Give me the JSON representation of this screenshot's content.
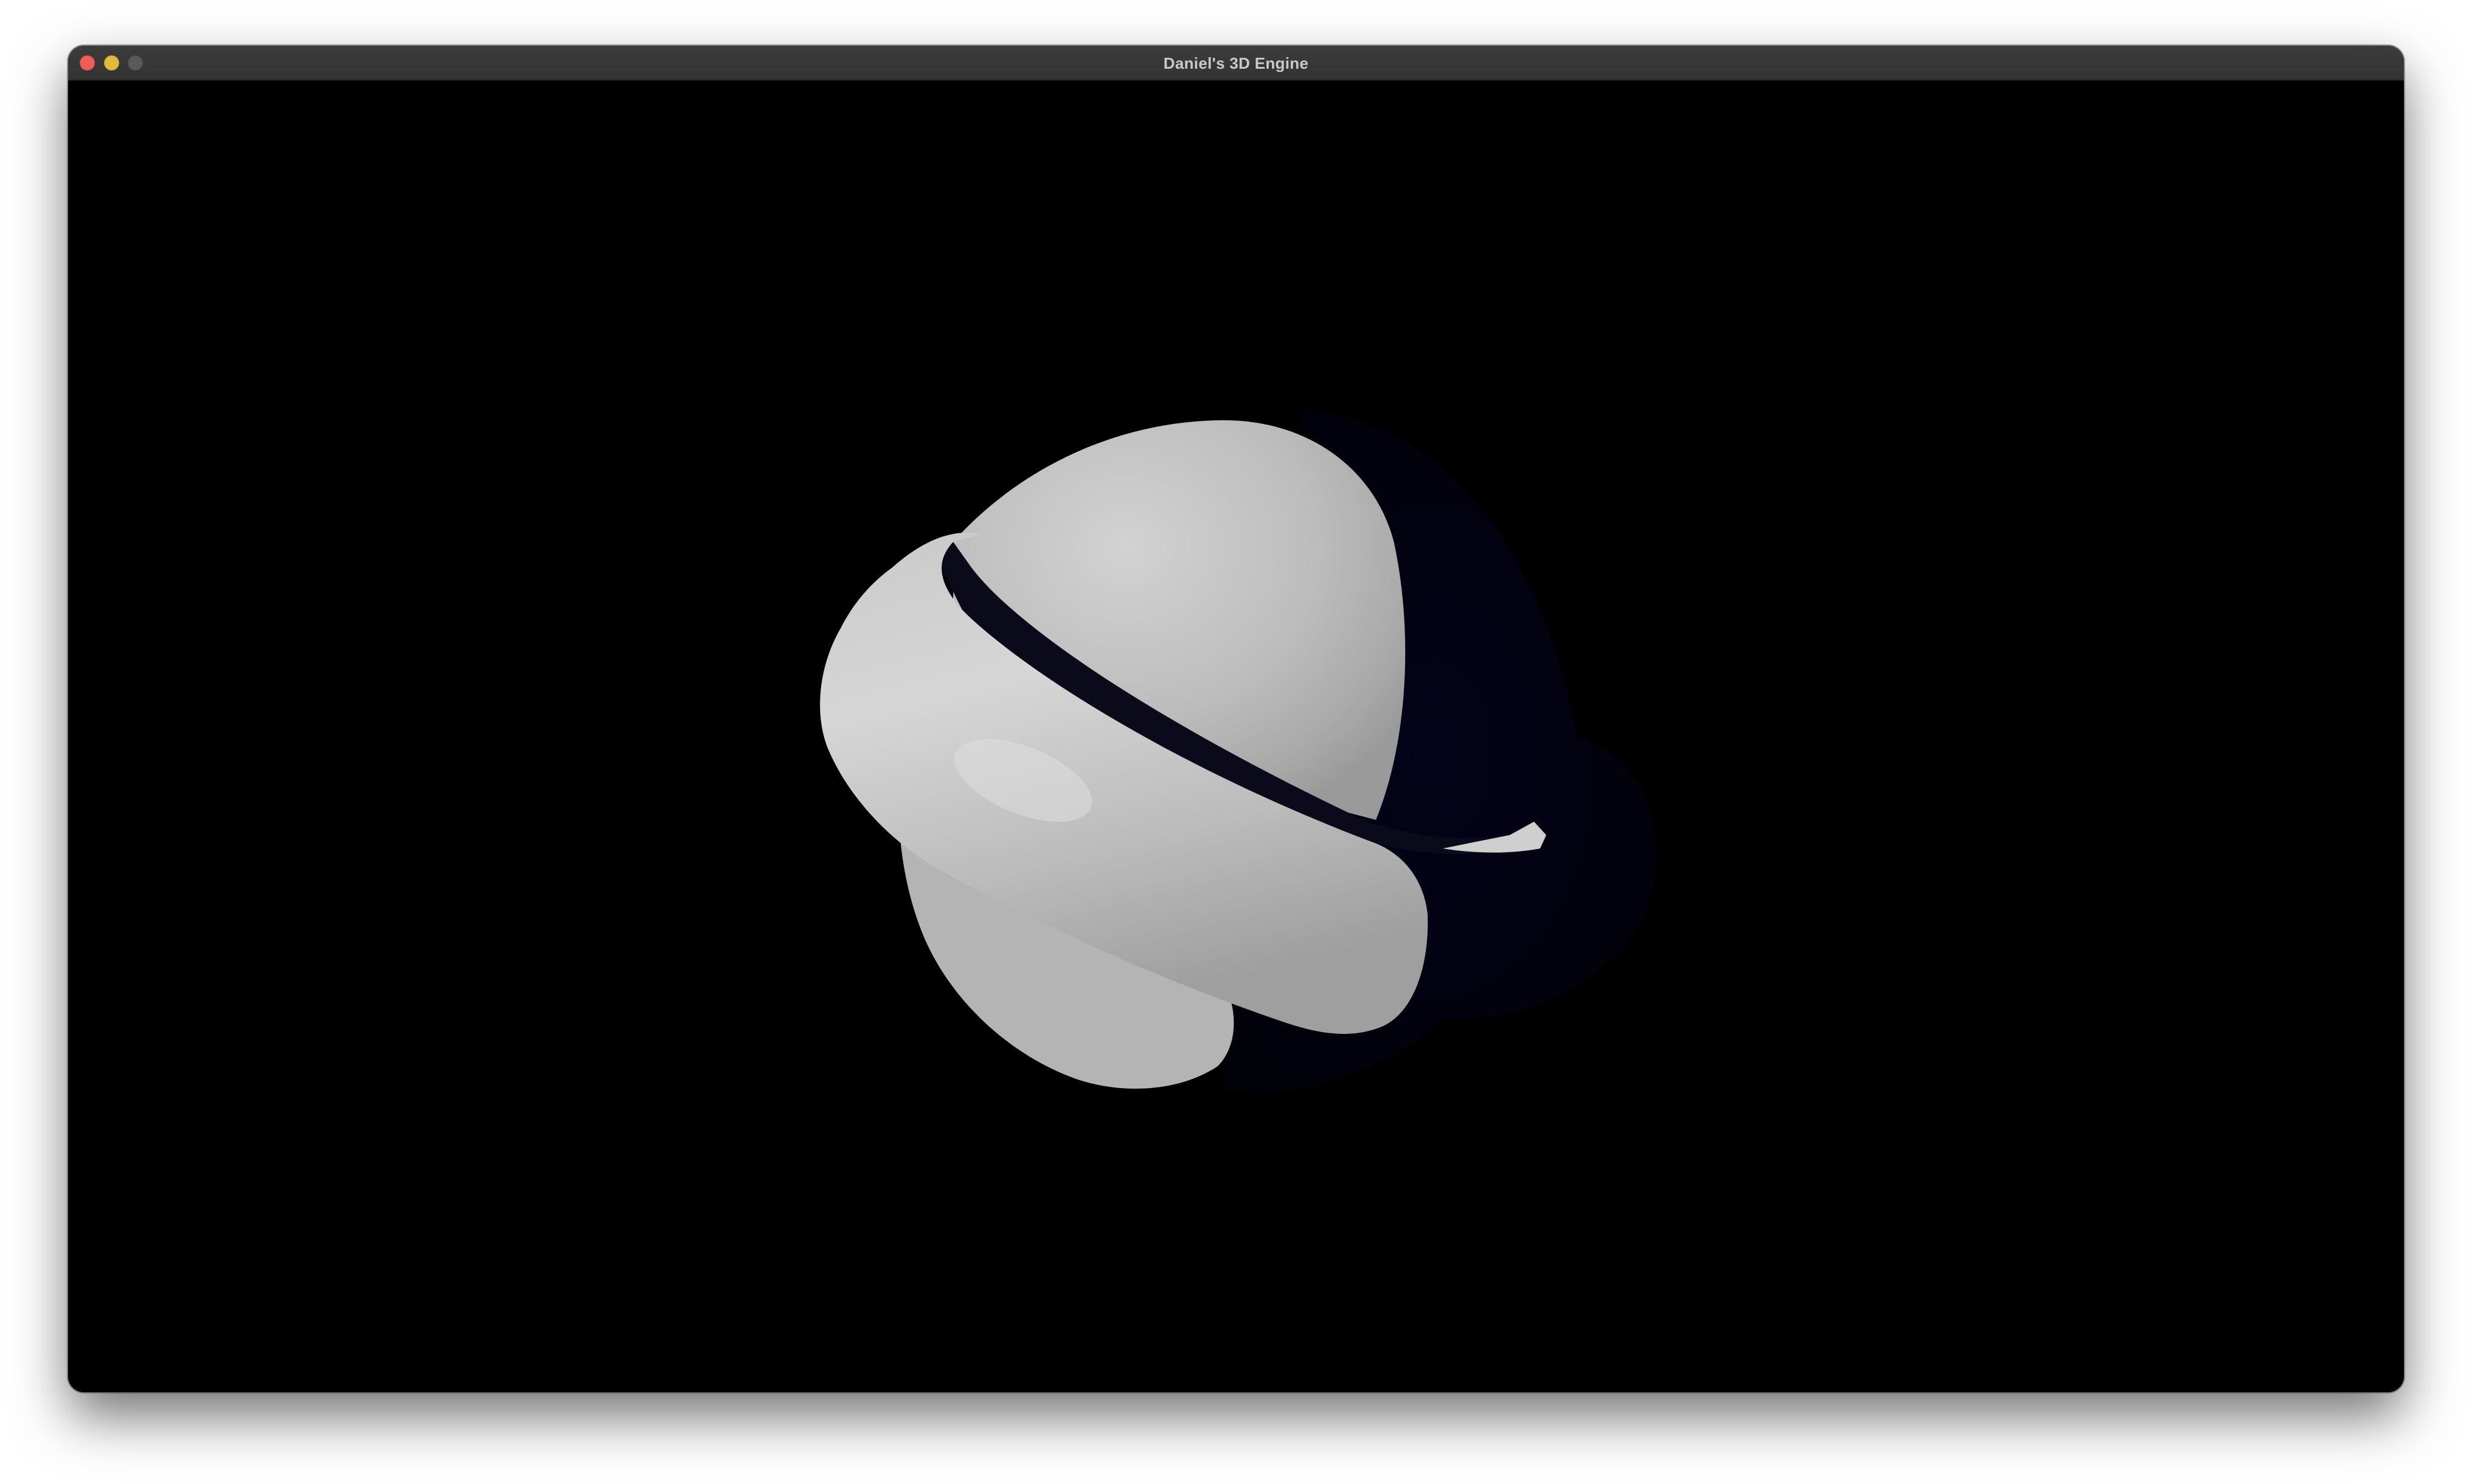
{
  "window": {
    "title": "Daniel's 3D Engine",
    "controls": {
      "close_color": "#ec5f57",
      "minimize_color": "#e0b93d",
      "maximize_color": "#5a5a5a"
    }
  },
  "viewport": {
    "background": "#000000",
    "scene": {
      "objects": [
        {
          "name": "sphere",
          "material_color": "#c8c8c8"
        },
        {
          "name": "torus",
          "material_color": "#d0d0d0"
        }
      ],
      "shadow_color": "#020214"
    }
  }
}
